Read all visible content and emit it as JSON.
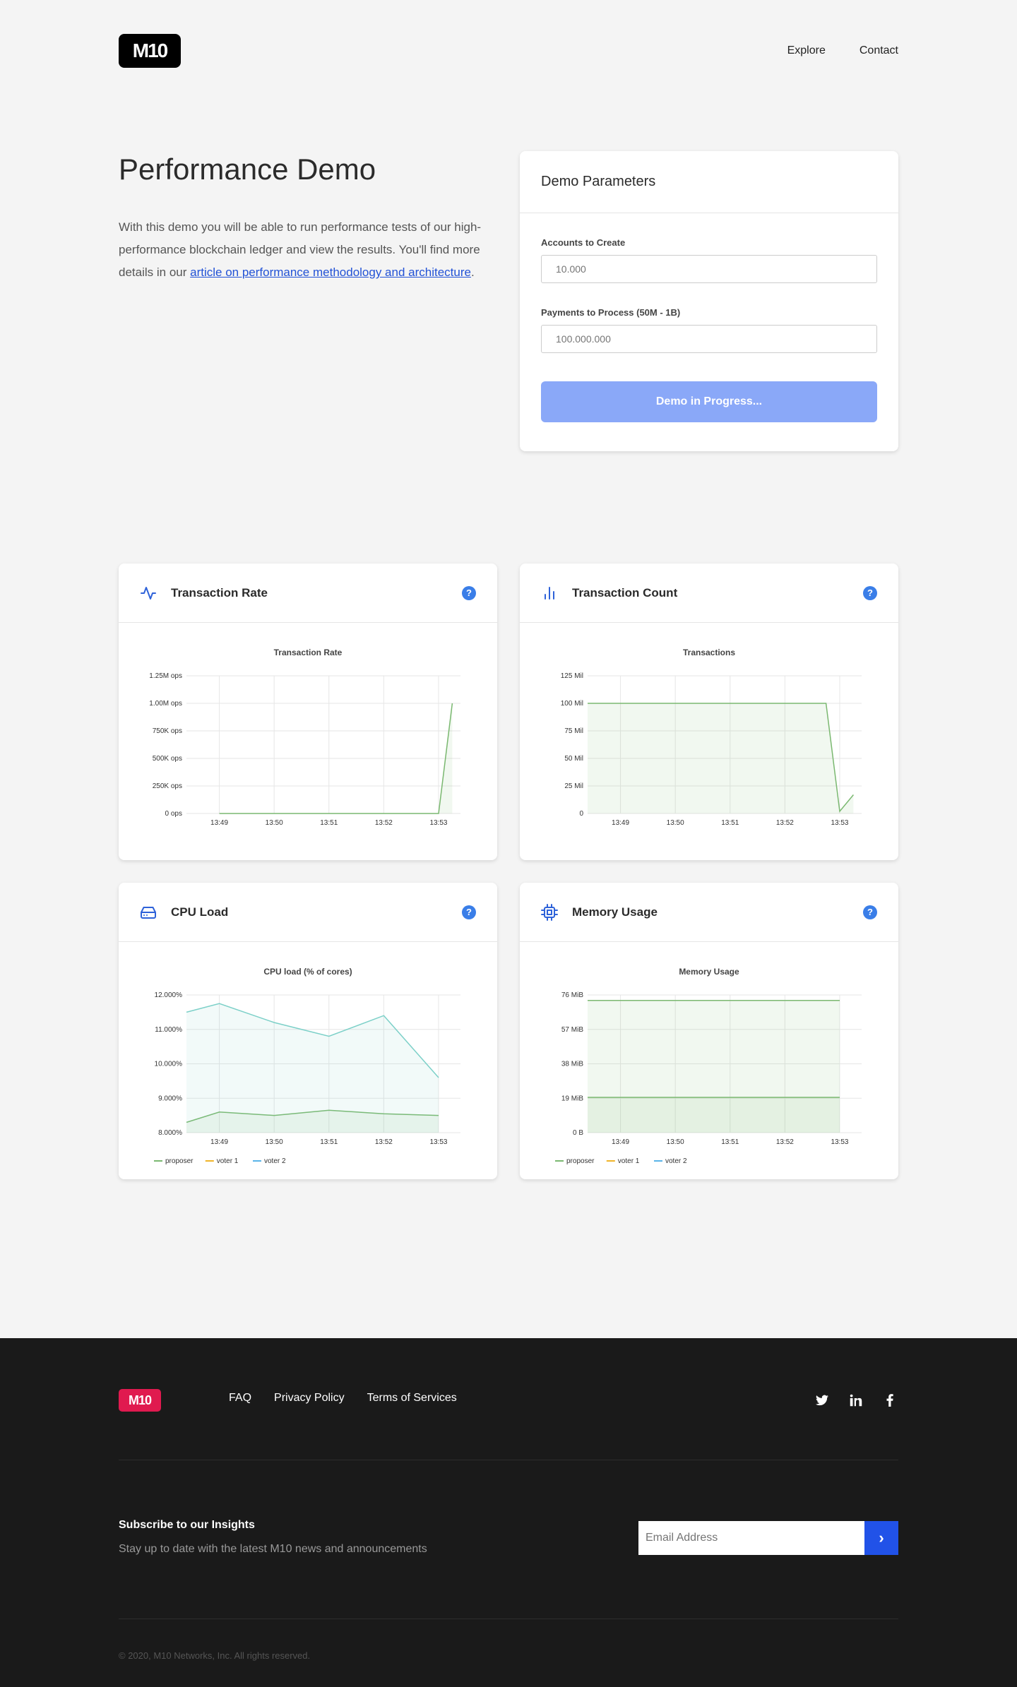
{
  "header": {
    "logo_text": "M10",
    "nav": [
      "Explore",
      "Contact"
    ]
  },
  "hero": {
    "title": "Performance Demo",
    "text_before": "With this demo you will be able to run performance tests of our high-performance blockchain ledger and view the results. You'll find more details in our ",
    "link_text": "article on performance methodology and architecture",
    "text_after": "."
  },
  "params": {
    "title": "Demo Parameters",
    "accounts_label": "Accounts to Create",
    "accounts_placeholder": "10.000",
    "payments_label": "Payments to Process (50M - 1B)",
    "payments_placeholder": "100.000.000",
    "button_label": "Demo in Progress..."
  },
  "cards": {
    "tx_rate": {
      "title": "Transaction Rate",
      "icon": "activity-icon"
    },
    "tx_count": {
      "title": "Transaction Count",
      "icon": "bar-chart-icon"
    },
    "cpu": {
      "title": "CPU Load",
      "icon": "hard-drive-icon"
    },
    "memory": {
      "title": "Memory Usage",
      "icon": "cpu-chip-icon"
    },
    "help_glyph": "?"
  },
  "chart_data": [
    {
      "type": "area",
      "title": "Transaction Rate",
      "x": [
        "13:49",
        "13:50",
        "13:51",
        "13:52",
        "13:53"
      ],
      "yticks": [
        "0 ops",
        "250K ops",
        "500K ops",
        "750K ops",
        "1.00M ops",
        "1.25M ops"
      ],
      "ylim": [
        0,
        1250000
      ],
      "series": [
        {
          "color": "#7ab870",
          "points": [
            [
              0,
              0
            ],
            [
              4.0,
              0
            ],
            [
              4.25,
              1000000
            ]
          ]
        }
      ]
    },
    {
      "type": "area",
      "title": "Transactions",
      "x": [
        "13:49",
        "13:50",
        "13:51",
        "13:52",
        "13:53"
      ],
      "yticks": [
        "0",
        "25 Mil",
        "50 Mil",
        "75 Mil",
        "100 Mil",
        "125 Mil"
      ],
      "ylim": [
        0,
        125
      ],
      "series": [
        {
          "color": "#7ab870",
          "points": [
            [
              -0.6,
              100
            ],
            [
              3.75,
              100
            ],
            [
              4.0,
              2
            ],
            [
              4.25,
              17
            ]
          ]
        }
      ]
    },
    {
      "type": "area",
      "title": "CPU load (% of cores)",
      "x": [
        "13:49",
        "13:50",
        "13:51",
        "13:52",
        "13:53"
      ],
      "yticks": [
        "8.000%",
        "9.000%",
        "10.000%",
        "11.000%",
        "12.000%"
      ],
      "ylim": [
        8,
        12
      ],
      "legend": [
        "proposer",
        "voter 1",
        "voter 2"
      ],
      "legend_colors": [
        "#7ab870",
        "#f0b429",
        "#5ab4e8"
      ],
      "series": [
        {
          "name": "proposer",
          "color": "#7ab870",
          "points": [
            [
              -0.6,
              8.3
            ],
            [
              0,
              8.6
            ],
            [
              1,
              8.5
            ],
            [
              2,
              8.65
            ],
            [
              3,
              8.55
            ],
            [
              4,
              8.5
            ]
          ]
        },
        {
          "name": "voter 2",
          "color": "#7cd0c8",
          "points": [
            [
              -0.6,
              11.5
            ],
            [
              0,
              11.75
            ],
            [
              1,
              11.2
            ],
            [
              2,
              10.8
            ],
            [
              3,
              11.4
            ],
            [
              4,
              9.6
            ]
          ]
        }
      ]
    },
    {
      "type": "area",
      "title": "Memory Usage",
      "x": [
        "13:49",
        "13:50",
        "13:51",
        "13:52",
        "13:53"
      ],
      "yticks": [
        "0 B",
        "19 MiB",
        "38 MiB",
        "57 MiB",
        "76 MiB"
      ],
      "ylim": [
        0,
        76
      ],
      "legend": [
        "proposer",
        "voter 1",
        "voter 2"
      ],
      "legend_colors": [
        "#7ab870",
        "#f0b429",
        "#5ab4e8"
      ],
      "series": [
        {
          "name": "proposer",
          "color": "#7ab870",
          "points": [
            [
              -0.6,
              73
            ],
            [
              4.0,
              73
            ]
          ]
        },
        {
          "name": "voter 1",
          "color": "#7ab870",
          "points": [
            [
              -0.6,
              19.5
            ],
            [
              4.0,
              19.5
            ]
          ]
        }
      ]
    }
  ],
  "footer": {
    "logo_text": "M10",
    "links": [
      "FAQ",
      "Privacy Policy",
      "Terms of Services"
    ],
    "social": [
      "twitter-icon",
      "linkedin-icon",
      "facebook-icon"
    ],
    "subscribe_title": "Subscribe to our Insights",
    "subscribe_text": "Stay up to date with the latest M10 news and announcements",
    "email_placeholder": "Email Address",
    "submit_glyph": "›",
    "copyright": "© 2020, M10 Networks, Inc. All rights reserved."
  }
}
